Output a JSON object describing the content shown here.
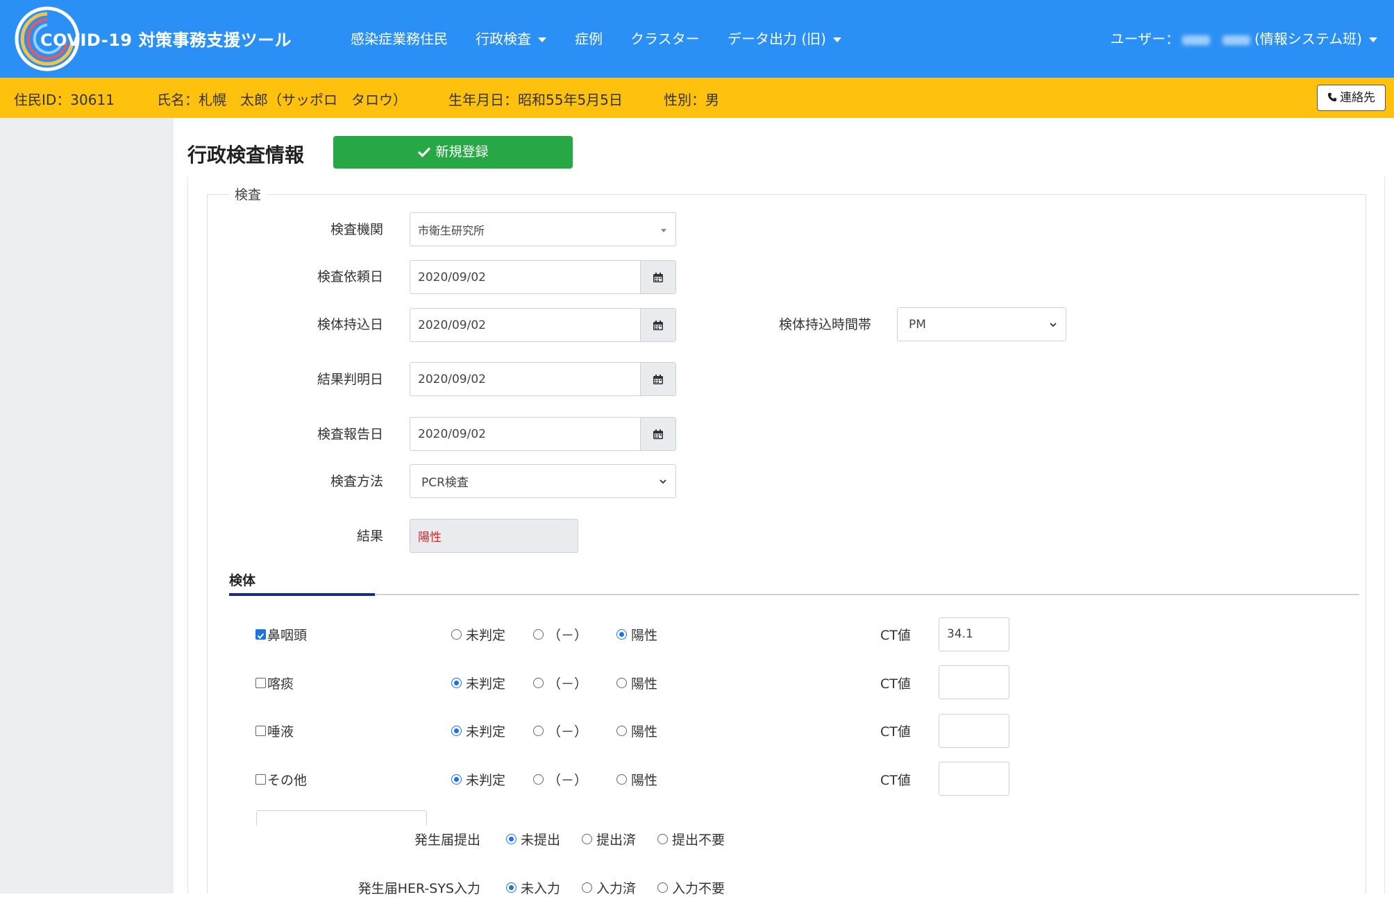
{
  "header": {
    "app_title": "COVID-19 対策事務支援ツール",
    "nav": [
      {
        "label": "感染症業務住民",
        "dropdown": false
      },
      {
        "label": "行政検査",
        "dropdown": true
      },
      {
        "label": "症例",
        "dropdown": false
      },
      {
        "label": "クラスター",
        "dropdown": false
      },
      {
        "label": "データ出力 (旧)",
        "dropdown": true
      }
    ],
    "user_prefix": "ユーザー：",
    "user_dept": "(情報システム班)"
  },
  "resident": {
    "id": "住民ID：30611",
    "name": "氏名：札幌　太郎（サッポロ　タロウ）",
    "birth": "生年月日：昭和55年5月5日",
    "sex": "性別：男",
    "contact_label": "連絡先"
  },
  "page": {
    "title": "行政検査情報",
    "new_button": "新規登録"
  },
  "exam": {
    "legend": "検査",
    "lab_label": "検査機関",
    "lab_value": "市衛生研究所",
    "request_date_label": "検査依頼日",
    "request_date": "2020/09/02",
    "bring_date_label": "検体持込日",
    "bring_date": "2020/09/02",
    "bring_time_label": "検体持込時間帯",
    "bring_time": "PM",
    "result_date_label": "結果判明日",
    "result_date": "2020/09/02",
    "report_date_label": "検査報告日",
    "report_date": "2020/09/02",
    "method_label": "検査方法",
    "method_value": "PCR検査",
    "result_label": "結果",
    "result_value": "陽性",
    "result_color": "#e02424"
  },
  "specimen": {
    "tab_label": "検体",
    "options": [
      "未判定",
      "（－）",
      "陽性"
    ],
    "ct_label": "CT値",
    "rows": [
      {
        "name": "鼻咽頭",
        "checked": true,
        "selected": 2,
        "ct": "34.1"
      },
      {
        "name": "喀痰",
        "checked": false,
        "selected": 0,
        "ct": ""
      },
      {
        "name": "唾液",
        "checked": false,
        "selected": 0,
        "ct": ""
      },
      {
        "name": "その他",
        "checked": false,
        "selected": 0,
        "ct": ""
      }
    ]
  },
  "notification": {
    "submit_label": "発生届提出",
    "submit_options": [
      "未提出",
      "提出済",
      "提出不要"
    ],
    "hersys_label": "発生届HER-SYS入力",
    "hersys_options": [
      "未入力",
      "入力済",
      "入力不要"
    ]
  },
  "colors": {
    "header": "#2b90f5",
    "resident_bar": "#fdc10e",
    "new_button": "#28a745"
  }
}
